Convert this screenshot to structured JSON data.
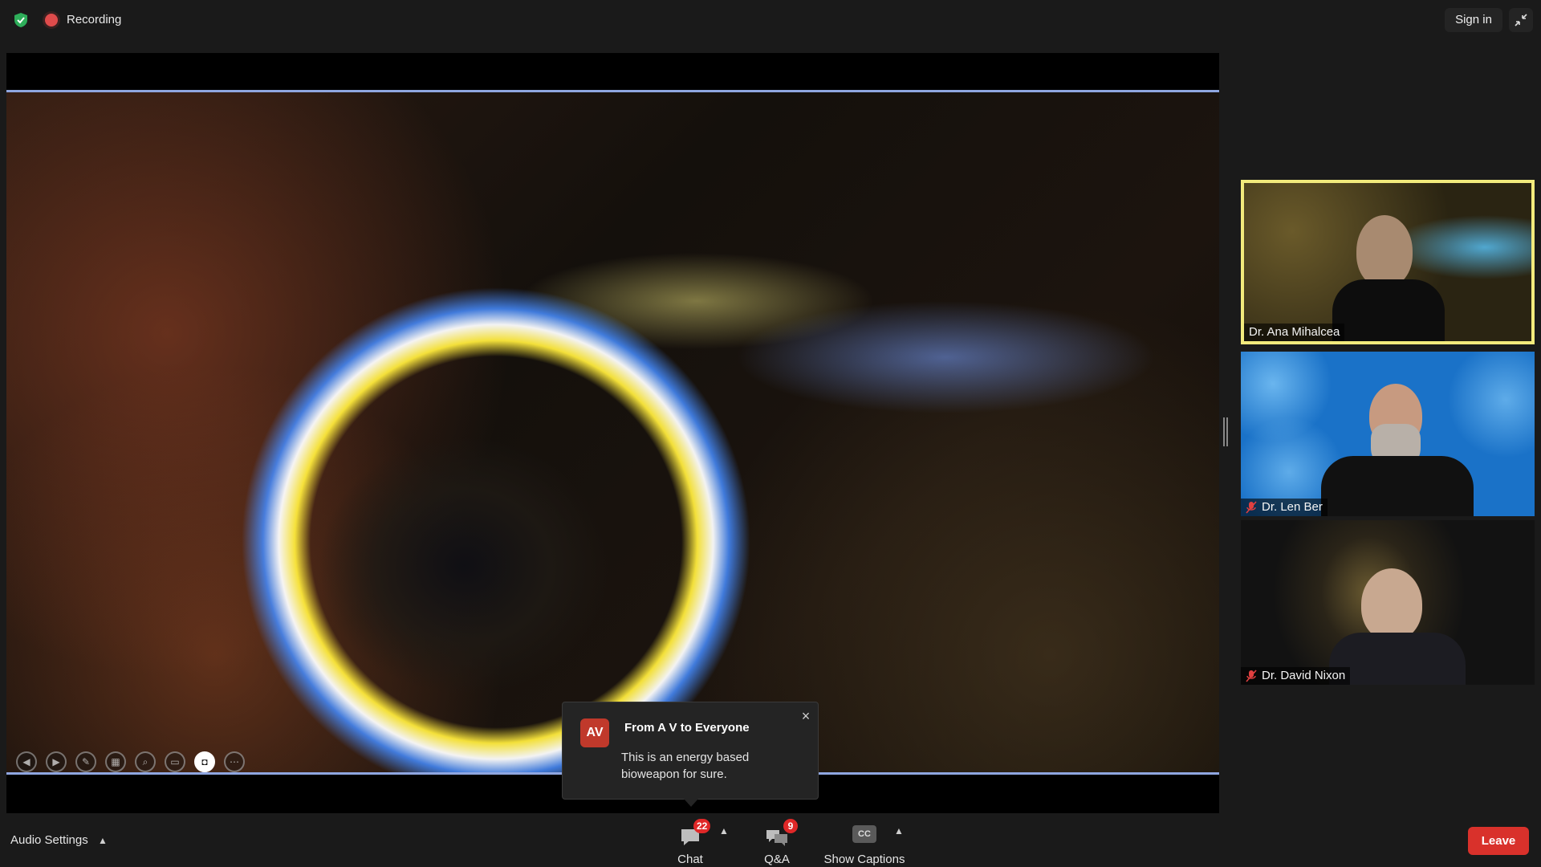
{
  "topbar": {
    "recording_label": "Recording",
    "sign_in_label": "Sign in"
  },
  "toast": {
    "avatar_initials": "AV",
    "title": "From A V to Everyone",
    "message": "This is an energy based bioweapon for sure.",
    "close_glyph": "×"
  },
  "participants": [
    {
      "name": "Dr. Ana Mihalcea",
      "muted": false,
      "active_speaker": true
    },
    {
      "name": "Dr. Len Ber",
      "muted": true,
      "active_speaker": false
    },
    {
      "name": "Dr. David Nixon",
      "muted": true,
      "active_speaker": false
    }
  ],
  "share_controls": [
    {
      "icon": "prev-icon",
      "glyph": "◀"
    },
    {
      "icon": "next-icon",
      "glyph": "▶"
    },
    {
      "icon": "pen-icon",
      "glyph": "✎"
    },
    {
      "icon": "thumbnails-icon",
      "glyph": "▦"
    },
    {
      "icon": "zoom-icon",
      "glyph": "⌕"
    },
    {
      "icon": "subtitles-icon",
      "glyph": "▭"
    },
    {
      "icon": "camera-icon",
      "glyph": "◘"
    },
    {
      "icon": "more-icon",
      "glyph": "⋯"
    }
  ],
  "bottombar": {
    "audio_settings_label": "Audio Settings",
    "chat_label": "Chat",
    "chat_badge": "22",
    "qa_label": "Q&A",
    "qa_badge": "9",
    "captions_label": "Show Captions",
    "captions_icon_text": "CC",
    "leave_label": "Leave"
  },
  "colors": {
    "leave": "#d9312b",
    "badge": "#e02828",
    "active_speaker_border": "#f2ea7c",
    "recording_dot": "#e04b4b",
    "shield": "#2eae5a"
  }
}
